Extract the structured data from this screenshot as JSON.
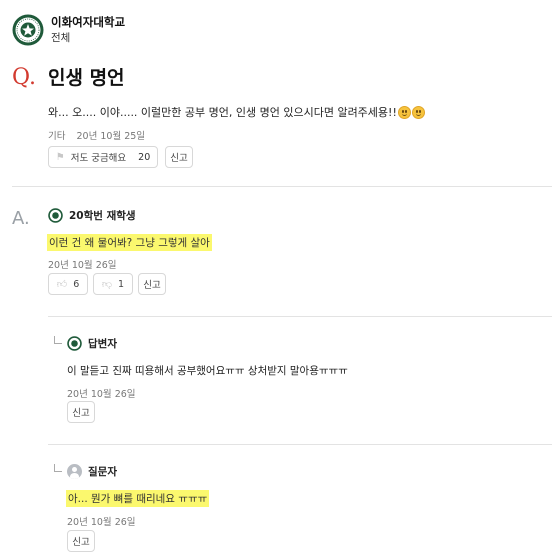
{
  "header": {
    "school_name": "이화여자대학교",
    "board_name": "전체"
  },
  "question": {
    "mark": "Q.",
    "title": "인생 명언",
    "body": "와... 오.... 이야..... 이럴만한 공부 명언, 인생 명언 있으시다면 알려주세용!!",
    "category": "기타",
    "date": "20년 10월 25일",
    "curious_label": "저도 궁금해요",
    "curious_count": "20",
    "report_label": "신고"
  },
  "answer": {
    "mark": "A.",
    "author": "20학번 재학생",
    "text": "이런 건 왜 물어봐? 그냥 그렇게 살아",
    "date": "20년 10월 26일",
    "like_count": "6",
    "dislike_count": "1",
    "report_label": "신고"
  },
  "comments": [
    {
      "author": "답변자",
      "text": "이 말듣고 진짜 띠용해서 공부했어요ㅠㅠ 상처받지 말아용ㅠㅠㅠ",
      "date": "20년 10월 26일",
      "report_label": "신고"
    },
    {
      "author": "질문자",
      "text": "아... 뭔가 뼈를 때리네요 ㅠㅠㅠ",
      "date": "20년 10월 26일",
      "report_label": "신고"
    }
  ],
  "icons": {
    "logo": "university-seal-icon",
    "curious": "flag-icon",
    "like": "thumbs-up-icon",
    "dislike": "thumbs-down-icon",
    "questioner_avatar": "user-icon",
    "emoji": "grinning-face-icon"
  },
  "colors": {
    "q_mark": "#d23a2f",
    "highlight": "#fbf86e",
    "logo_green": "#1f5a3a"
  }
}
